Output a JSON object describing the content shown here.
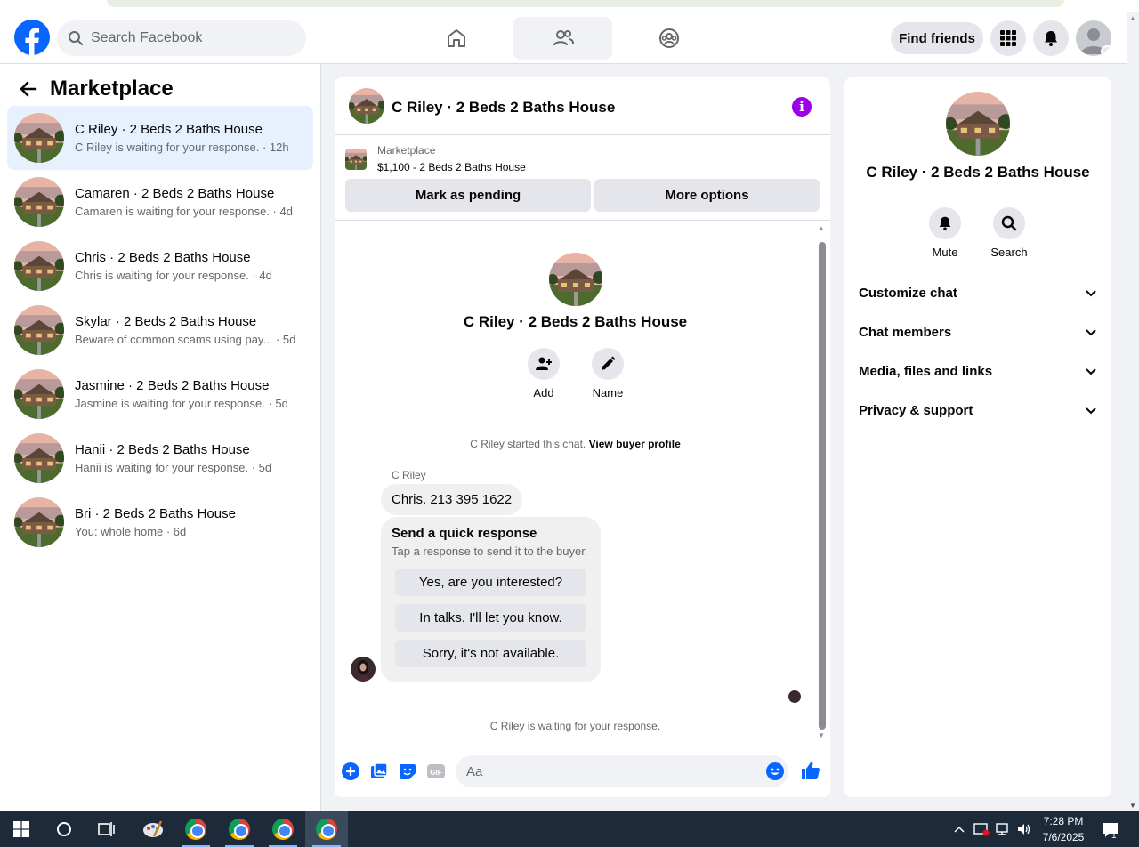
{
  "topbar": {
    "search_placeholder": "Search Facebook",
    "find_friends": "Find friends"
  },
  "left": {
    "title": "Marketplace",
    "conversations": [
      {
        "name": "C Riley · 2 Beds 2 Baths House",
        "sub": "C Riley is waiting for your response. · 12h"
      },
      {
        "name": "Camaren · 2 Beds 2 Baths House",
        "sub": "Camaren is waiting for your response. · 4d"
      },
      {
        "name": "Chris · 2 Beds 2 Baths House",
        "sub": "Chris is waiting for your response. · 4d"
      },
      {
        "name": "Skylar · 2 Beds 2 Baths House",
        "sub": "Beware of common scams using pay...   · 5d"
      },
      {
        "name": "Jasmine · 2 Beds 2 Baths House",
        "sub": "Jasmine is waiting for your response. · 5d"
      },
      {
        "name": "Hanii · 2 Beds 2 Baths House",
        "sub": "Hanii is waiting for your response. · 5d"
      },
      {
        "name": "Bri · 2 Beds 2 Baths House",
        "sub": "You: whole home · 6d"
      }
    ]
  },
  "chat": {
    "title": "C Riley · 2 Beds 2 Baths House",
    "listing_source": "Marketplace",
    "listing_desc": "$1,100 - 2 Beds 2 Baths House",
    "mark_pending": "Mark as pending",
    "more_options": "More options",
    "center_title": "C Riley · 2 Beds 2 Baths House",
    "add_label": "Add",
    "name_label": "Name",
    "started_text": "C Riley started this chat.",
    "view_profile": "View buyer profile",
    "sender": "C Riley",
    "message": "Chris. 213 395 1622",
    "quick_title": "Send a quick response",
    "quick_sub": "Tap a response to send it to the buyer.",
    "quick_responses": [
      "Yes, are you interested?",
      "In talks. I'll let you know.",
      "Sorry, it's not available."
    ],
    "waiting": "C Riley is waiting for your response.",
    "composer_placeholder": "Aa"
  },
  "right": {
    "title": "C Riley · 2 Beds 2 Baths House",
    "mute": "Mute",
    "search": "Search",
    "sections": [
      "Customize chat",
      "Chat members",
      "Media, files and links",
      "Privacy & support"
    ]
  },
  "taskbar": {
    "time": "7:28 PM",
    "date": "7/6/2025",
    "notification_count": "1"
  },
  "colors": {
    "brand": "#0866ff",
    "active_conversation": "#e7f0fd",
    "info_icon": "#9b00e8"
  }
}
